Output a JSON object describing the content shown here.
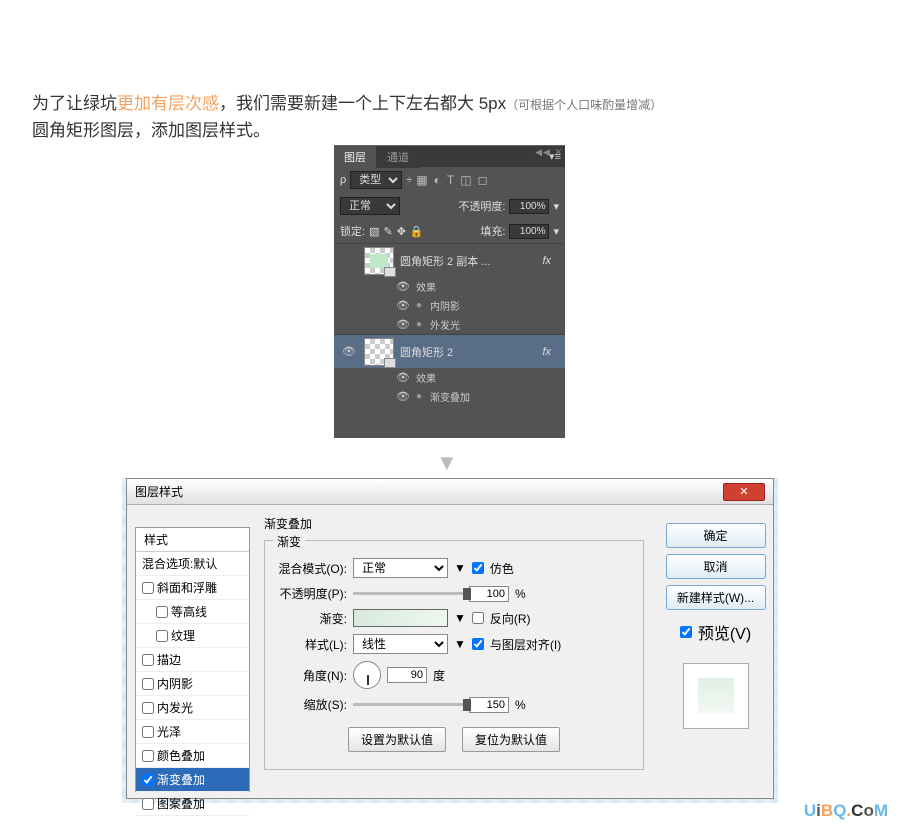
{
  "intro": {
    "p1a": "为了让绿坑",
    "p1hl": "更加有层次感",
    "p1b": "，我们需要新建一个上下左右都大 5px",
    "p1sm": "（可根据个人口味酌量增减）",
    "p2": "圆角矩形图层，添加图层样式。"
  },
  "layers_panel": {
    "tabs": {
      "layers": "图层",
      "channels": "通道"
    },
    "type_label": "类型",
    "blend": "正常",
    "opacity_label": "不透明度:",
    "opacity_val": "100%",
    "lock_label": "锁定:",
    "fill_label": "填充:",
    "fill_val": "100%",
    "layer1": {
      "name": "圆角矩形 2 副本 ...",
      "fx": "fx",
      "effects": "效果",
      "inner_shadow": "内阴影",
      "outer_glow": "外发光"
    },
    "layer2": {
      "name": "圆角矩形 2",
      "fx": "fx",
      "effects": "效果",
      "grad": "渐变叠加"
    }
  },
  "dialog": {
    "title": "图层样式",
    "close": "✕",
    "left": {
      "styles": "样式",
      "blending": "混合选项:默认",
      "bevel": "斜面和浮雕",
      "contour": "等高线",
      "texture": "纹理",
      "stroke": "描边",
      "inner_shadow": "内阴影",
      "inner_glow": "内发光",
      "satin": "光泽",
      "color_overlay": "颜色叠加",
      "grad_overlay": "渐变叠加",
      "pattern_overlay": "图案叠加"
    },
    "mid": {
      "group_title": "渐变叠加",
      "group_sub": "渐变",
      "blend_mode": "混合模式(O):",
      "blend_val": "正常",
      "dither": "仿色",
      "opacity": "不透明度(P):",
      "opacity_val": "100",
      "pct": "%",
      "gradient": "渐变:",
      "reverse": "反向(R)",
      "style": "样式(L):",
      "style_val": "线性",
      "align": "与图层对齐(I)",
      "angle": "角度(N):",
      "angle_val": "90",
      "deg": "度",
      "scale": "缩放(S):",
      "scale_val": "150",
      "set_default": "设置为默认值",
      "reset_default": "复位为默认值"
    },
    "right": {
      "ok": "确定",
      "cancel": "取消",
      "new_style": "新建样式(W)...",
      "preview": "预览(V)"
    }
  },
  "watermark": {
    "u": "U",
    "i": "i",
    "b": "B",
    "q": "Q",
    "dot": ".",
    "c": "C",
    "o": "o",
    "m": "M"
  }
}
